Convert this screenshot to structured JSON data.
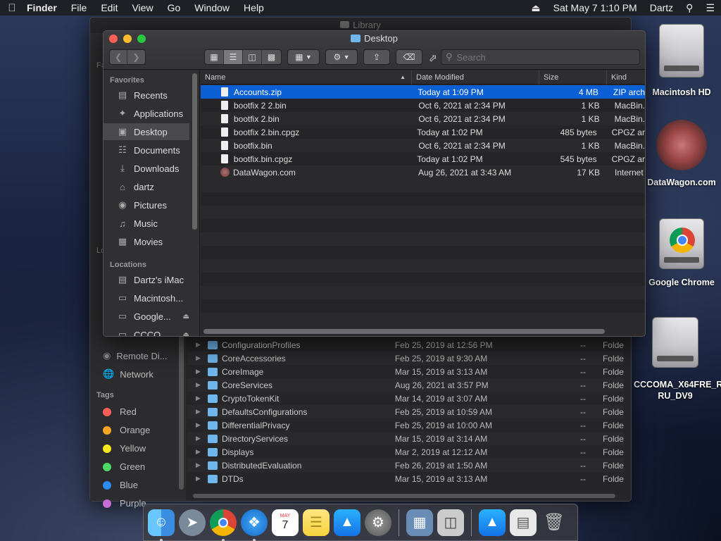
{
  "menubar": {
    "app": "Finder",
    "items": [
      "File",
      "Edit",
      "View",
      "Go",
      "Window",
      "Help"
    ],
    "datetime": "Sat May 7  1:10 PM",
    "user": "Dartz"
  },
  "desktop_icons": [
    {
      "label": "Macintosh HD"
    },
    {
      "label": "DataWagon.com"
    },
    {
      "label": "Google Chrome"
    },
    {
      "label": "CCCOMA_X64FRE_RU-RU_DV9"
    }
  ],
  "back_window": {
    "title": "Library",
    "sidebar": {
      "fav_partial": "Fa",
      "loc_partial": "Lo",
      "remote_partial": "Remote Di...",
      "network": "Network",
      "tags_header": "Tags",
      "tags": [
        {
          "name": "Red",
          "color": "#ff5f57"
        },
        {
          "name": "Orange",
          "color": "#f5a623"
        },
        {
          "name": "Yellow",
          "color": "#f8e71c"
        },
        {
          "name": "Green",
          "color": "#4cd964"
        },
        {
          "name": "Blue",
          "color": "#2d8cf0"
        },
        {
          "name": "Purple",
          "color": "#c86dd7"
        }
      ]
    },
    "rows": [
      {
        "name": "ConfigurationProfiles",
        "date": "Feb 25, 2019 at 12:56 PM",
        "size": "--",
        "kind": "Folde"
      },
      {
        "name": "CoreAccessories",
        "date": "Feb 25, 2019 at 9:30 AM",
        "size": "--",
        "kind": "Folde"
      },
      {
        "name": "CoreImage",
        "date": "Mar 15, 2019 at 3:13 AM",
        "size": "--",
        "kind": "Folde"
      },
      {
        "name": "CoreServices",
        "date": "Aug 26, 2021 at 3:57 PM",
        "size": "--",
        "kind": "Folde"
      },
      {
        "name": "CryptoTokenKit",
        "date": "Mar 14, 2019 at 3:07 AM",
        "size": "--",
        "kind": "Folde"
      },
      {
        "name": "DefaultsConfigurations",
        "date": "Feb 25, 2019 at 10:59 AM",
        "size": "--",
        "kind": "Folde"
      },
      {
        "name": "DifferentialPrivacy",
        "date": "Feb 25, 2019 at 10:00 AM",
        "size": "--",
        "kind": "Folde"
      },
      {
        "name": "DirectoryServices",
        "date": "Mar 15, 2019 at 3:14 AM",
        "size": "--",
        "kind": "Folde"
      },
      {
        "name": "Displays",
        "date": "Mar 2, 2019 at 12:12 AM",
        "size": "--",
        "kind": "Folde"
      },
      {
        "name": "DistributedEvaluation",
        "date": "Feb 26, 2019 at 1:50 AM",
        "size": "--",
        "kind": "Folde"
      },
      {
        "name": "DTDs",
        "date": "Mar 15, 2019 at 3:13 AM",
        "size": "--",
        "kind": "Folde"
      }
    ]
  },
  "window": {
    "title": "Desktop",
    "search_placeholder": "Search",
    "sidebar": {
      "favorites_header": "Favorites",
      "favorites": [
        "Recents",
        "Applications",
        "Desktop",
        "Documents",
        "Downloads",
        "dartz",
        "Pictures",
        "Music",
        "Movies"
      ],
      "locations_header": "Locations",
      "locations": [
        "Dartz's iMac",
        "Macintosh...",
        "Google...",
        "CCCO..."
      ]
    },
    "columns": {
      "name": "Name",
      "date": "Date Modified",
      "size": "Size",
      "kind": "Kind"
    },
    "files": [
      {
        "name": "Accounts.zip",
        "date": "Today at 1:09 PM",
        "size": "4 MB",
        "kind": "ZIP arch"
      },
      {
        "name": "bootfix 2 2.bin",
        "date": "Oct 6, 2021 at 2:34 PM",
        "size": "1 KB",
        "kind": "MacBin."
      },
      {
        "name": "bootfix 2.bin",
        "date": "Oct 6, 2021 at 2:34 PM",
        "size": "1 KB",
        "kind": "MacBin."
      },
      {
        "name": "bootfix 2.bin.cpgz",
        "date": "Today at 1:02 PM",
        "size": "485 bytes",
        "kind": "CPGZ ar"
      },
      {
        "name": "bootfix.bin",
        "date": "Oct 6, 2021 at 2:34 PM",
        "size": "1 KB",
        "kind": "MacBin."
      },
      {
        "name": "bootfix.bin.cpgz",
        "date": "Today at 1:02 PM",
        "size": "545 bytes",
        "kind": "CPGZ ar"
      },
      {
        "name": "DataWagon.com",
        "date": "Aug 26, 2021 at 3:43 AM",
        "size": "17 KB",
        "kind": "Internet"
      }
    ]
  },
  "dock": {
    "calendar_month": "MAY",
    "calendar_day": "7"
  }
}
